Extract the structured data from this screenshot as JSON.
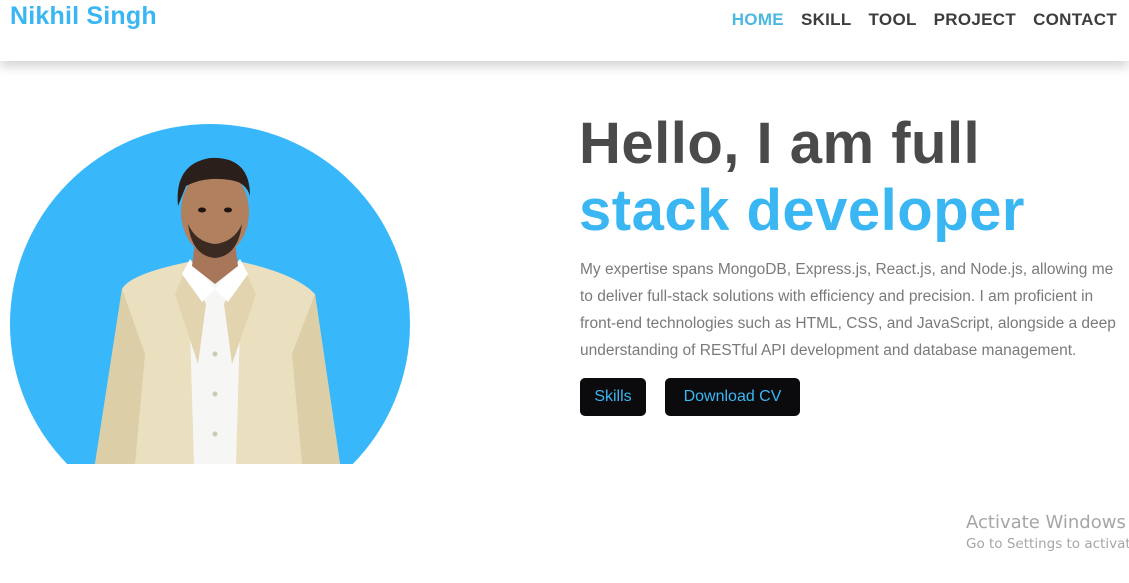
{
  "brand": {
    "name": "Nikhil Singh"
  },
  "nav": {
    "items": [
      {
        "label": "HOME",
        "active": true
      },
      {
        "label": "SKILL",
        "active": false
      },
      {
        "label": "TOOL",
        "active": false
      },
      {
        "label": "PROJECT",
        "active": false
      },
      {
        "label": "CONTACT",
        "active": false
      }
    ]
  },
  "hero": {
    "title_line1": "Hello, I am full",
    "title_line2": "stack developer",
    "description": "My expertise spans MongoDB, Express.js, React.js, and Node.js, allowing me to deliver full-stack solutions with efficiency and precision. I am proficient in front-end technologies such as HTML, CSS, and JavaScript, alongside a deep understanding of RESTful API development and database management.",
    "buttons": {
      "skills": "Skills",
      "download_cv": "Download CV"
    }
  },
  "watermark": {
    "title": "Activate Windows",
    "subtitle": "Go to Settings to activate"
  },
  "colors": {
    "accent": "#3ab6f2",
    "nav_active": "#4bb8e0",
    "heading": "#4a4a4a",
    "body_text": "#7a7a7a",
    "button_bg": "#0b0b0d",
    "circle": "#38b7fb"
  }
}
